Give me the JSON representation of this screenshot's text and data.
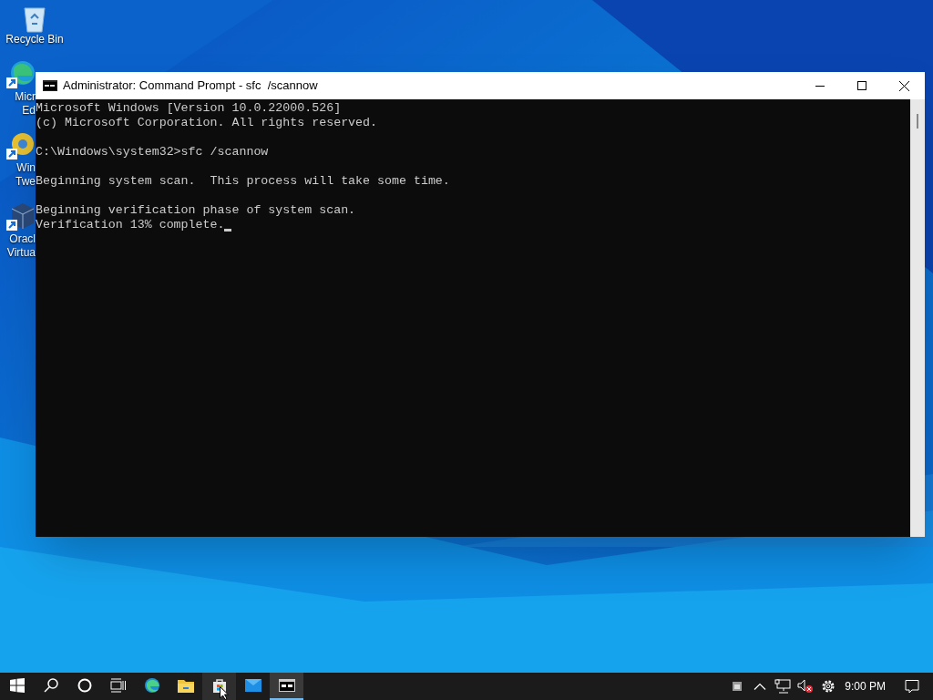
{
  "desktop_icons": [
    {
      "kind": "recycle-bin",
      "label_lines": [
        "Recycle Bin"
      ]
    },
    {
      "kind": "edge-shortcut",
      "label_lines": [
        "Micr",
        "Ed"
      ]
    },
    {
      "kind": "tweaker-shortcut",
      "label_lines": [
        "Win",
        "Twe"
      ]
    },
    {
      "kind": "box-shortcut",
      "label_lines": [
        "Oracl",
        "Virtua"
      ]
    }
  ],
  "window": {
    "title": "Administrator: Command Prompt - sfc  /scannow",
    "console_blocks": [
      [
        "Microsoft Windows [Version 10.0.22000.526]",
        "(c) Microsoft Corporation. All rights reserved."
      ],
      [
        "C:\\Windows\\system32>sfc /scannow"
      ],
      [
        "Beginning system scan.  This process will take some time."
      ],
      [
        "Beginning verification phase of system scan.",
        "Verification 13% complete."
      ]
    ]
  },
  "taskbar": {
    "items": [
      {
        "kind": "start",
        "selected": false
      },
      {
        "kind": "search",
        "selected": false
      },
      {
        "kind": "cortana",
        "selected": false
      },
      {
        "kind": "task-view",
        "selected": false
      },
      {
        "kind": "edge",
        "selected": false
      },
      {
        "kind": "folder",
        "selected": false
      },
      {
        "kind": "store",
        "selected": false,
        "hovered": true
      },
      {
        "kind": "mail",
        "selected": false
      },
      {
        "kind": "terminal",
        "selected": true
      }
    ],
    "tray": [
      {
        "kind": "meet"
      },
      {
        "kind": "chevron"
      },
      {
        "kind": "network"
      },
      {
        "kind": "volume-muted"
      },
      {
        "kind": "settings"
      }
    ],
    "clock": "9:00 PM"
  }
}
